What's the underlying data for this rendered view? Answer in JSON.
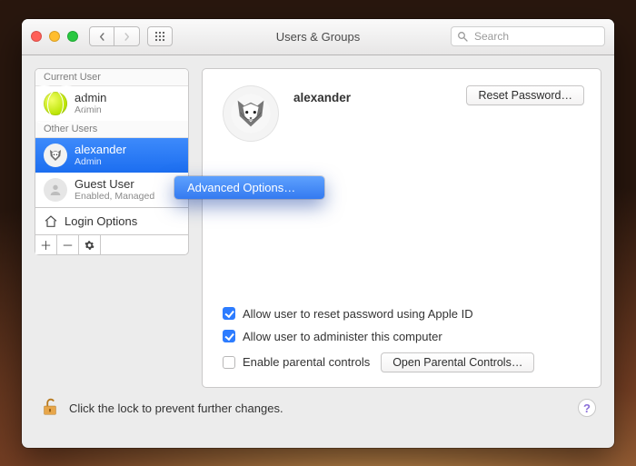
{
  "toolbar": {
    "title": "Users & Groups",
    "search_placeholder": "Search"
  },
  "sidebar": {
    "section_current": "Current User",
    "section_other": "Other Users",
    "current_user": {
      "name": "admin",
      "role": "Admin"
    },
    "other": [
      {
        "name": "alexander",
        "role": "Admin"
      },
      {
        "name": "Guest User",
        "role": "Enabled, Managed"
      }
    ],
    "login_options": "Login Options"
  },
  "context_menu": {
    "advanced": "Advanced Options…"
  },
  "panel": {
    "user_name": "alexander",
    "reset_password": "Reset Password…",
    "allow_reset_apple_id": "Allow user to reset password using Apple ID",
    "allow_admin": "Allow user to administer this computer",
    "parental_label": "Enable parental controls",
    "parental_button": "Open Parental Controls…"
  },
  "footer": {
    "lock_text": "Click the lock to prevent further changes."
  }
}
